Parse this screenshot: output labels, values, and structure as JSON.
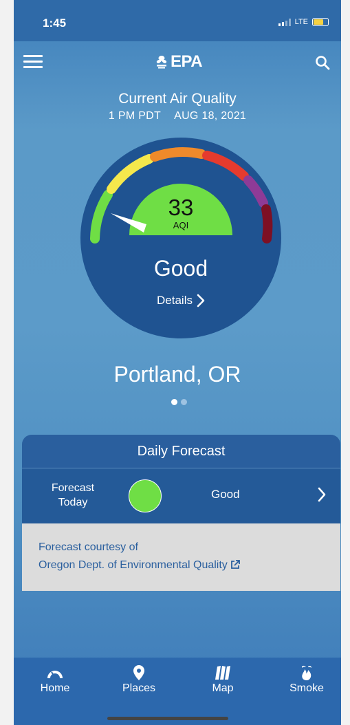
{
  "status_bar": {
    "time": "1:45",
    "network": "LTE"
  },
  "header": {
    "logo_text": "EPA"
  },
  "current": {
    "title": "Current Air Quality",
    "time": "1 PM PDT",
    "date": "AUG 18, 2021",
    "aqi_value": "33",
    "aqi_label": "AQI",
    "category": "Good",
    "details_label": "Details",
    "category_color": "#6fde45"
  },
  "location": {
    "city": "Portland, OR",
    "page_index": 0,
    "page_count": 2
  },
  "forecast": {
    "title": "Daily Forecast",
    "row_label": "Forecast Today",
    "status": "Good",
    "status_color": "#6fde45",
    "courtesy_text": "Forecast courtesy of",
    "agency": "Oregon Dept. of Environmental Quality"
  },
  "tabs": [
    {
      "label": "Home",
      "icon": "gauge-icon"
    },
    {
      "label": "Places",
      "icon": "location-pin-icon"
    },
    {
      "label": "Map",
      "icon": "map-icon"
    },
    {
      "label": "Smoke",
      "icon": "smoke-icon"
    }
  ],
  "colors": {
    "aqi_scale": [
      "#6fde45",
      "#f5e84c",
      "#ef8a2b",
      "#e53b2e",
      "#8e3b97",
      "#7d1024"
    ]
  }
}
